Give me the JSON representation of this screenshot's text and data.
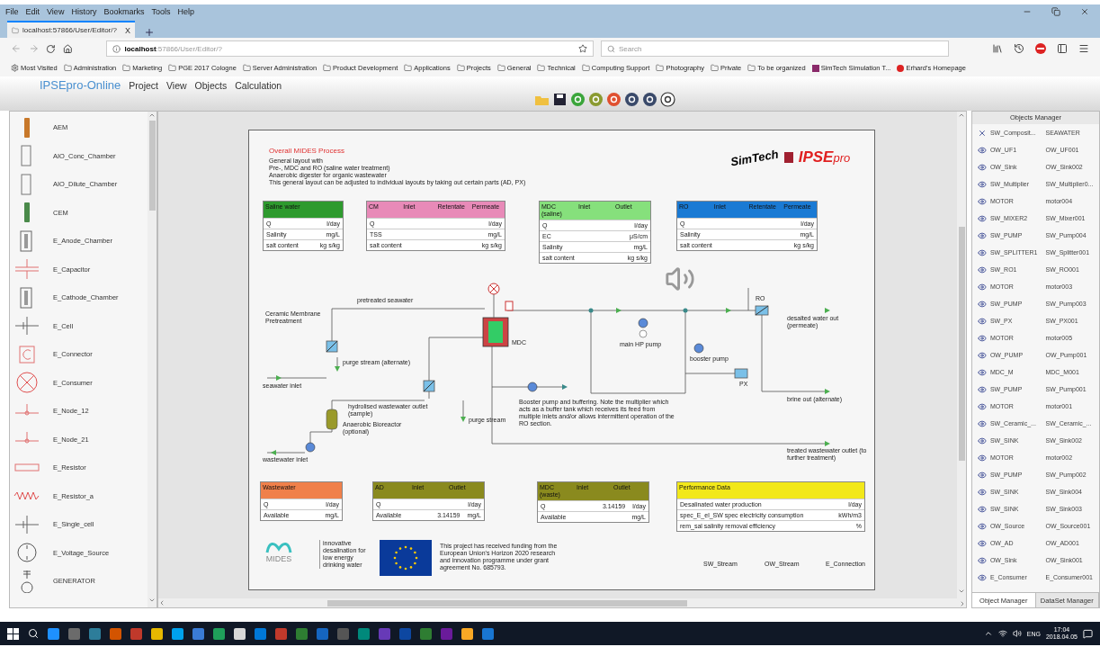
{
  "browser": {
    "menu": [
      "File",
      "Edit",
      "View",
      "History",
      "Bookmarks",
      "Tools",
      "Help"
    ],
    "tab": {
      "title": "localhost:57866/User/Editor/?",
      "close": "X"
    },
    "url_host": "localhost",
    "url_rest": ":57866/User/Editor/?",
    "search_placeholder": "Search",
    "bookmarks": [
      {
        "label": "Most Visited",
        "kind": "gear"
      },
      {
        "label": "Administration",
        "kind": "folder"
      },
      {
        "label": "Marketing",
        "kind": "folder"
      },
      {
        "label": "PGE 2017 Cologne",
        "kind": "folder"
      },
      {
        "label": "Server Administration",
        "kind": "folder"
      },
      {
        "label": "Product Development",
        "kind": "folder"
      },
      {
        "label": "Applications",
        "kind": "folder"
      },
      {
        "label": "Projects",
        "kind": "folder"
      },
      {
        "label": "General",
        "kind": "folder"
      },
      {
        "label": "Technical",
        "kind": "folder"
      },
      {
        "label": "Computing Support",
        "kind": "folder"
      },
      {
        "label": "Photography",
        "kind": "folder"
      },
      {
        "label": "Private",
        "kind": "folder"
      },
      {
        "label": "To be organized",
        "kind": "folder"
      },
      {
        "label": "SimTech Simulation T...",
        "kind": "site"
      },
      {
        "label": "Erhard's Homepage",
        "kind": "home"
      }
    ]
  },
  "app": {
    "brand": "IPSEpro-Online",
    "menu": [
      "Project",
      "View",
      "Objects",
      "Calculation"
    ]
  },
  "palette": [
    {
      "label": "AEM",
      "kind": "membrane",
      "color": "#c8782a"
    },
    {
      "label": "AIO_Conc_Chamber",
      "kind": "chamber"
    },
    {
      "label": "AIO_Dilute_Chamber",
      "kind": "chamber"
    },
    {
      "label": "CEM",
      "kind": "membrane",
      "color": "#4a8a4a"
    },
    {
      "label": "E_Anode_Chamber",
      "kind": "electrode_chamber"
    },
    {
      "label": "E_Capacitor",
      "kind": "capacitor"
    },
    {
      "label": "E_Cathode_Chamber",
      "kind": "electrode_chamber"
    },
    {
      "label": "E_Cell",
      "kind": "cell"
    },
    {
      "label": "E_Connector",
      "kind": "connector"
    },
    {
      "label": "E_Consumer",
      "kind": "consumer"
    },
    {
      "label": "E_Node_12",
      "kind": "node"
    },
    {
      "label": "E_Node_21",
      "kind": "node"
    },
    {
      "label": "E_Resistor",
      "kind": "resistor"
    },
    {
      "label": "E_Resistor_a",
      "kind": "resistor_wave"
    },
    {
      "label": "E_Single_cell",
      "kind": "cell"
    },
    {
      "label": "E_Voltage_Source",
      "kind": "voltage_source"
    },
    {
      "label": "GENERATOR",
      "kind": "generator"
    }
  ],
  "sheet": {
    "title": "Overall MIDES Process",
    "notes": [
      "General layout with",
      "Pre-, MDC and RO (saline water treatment)",
      "Anaerobic digester for organic wastewater",
      "This general layout can be adjusted to individual layouts by taking out certain parts (AD, PX)"
    ],
    "logo_left": "SimTech",
    "logo_right": "IPSE",
    "logo_suffix": "pro",
    "top_tables": [
      {
        "color": "#2e9a2e",
        "headers": [
          "Saline water"
        ],
        "rows": [
          [
            "Q",
            "l/day"
          ],
          [
            "Salinity",
            "mg/L"
          ],
          [
            "salt content",
            "kg s/kg"
          ]
        ]
      },
      {
        "color": "#e88ab8",
        "headers": [
          "CM",
          "Inlet",
          "Retentate",
          "Permeate"
        ],
        "rows": [
          [
            "Q",
            "l/day"
          ],
          [
            "TSS",
            "mg/L"
          ],
          [
            "salt content",
            "kg s/kg"
          ]
        ]
      },
      {
        "color": "#86e07c",
        "headers": [
          "MDC (saline)",
          "Inlet",
          "Outlet"
        ],
        "rows": [
          [
            "Q",
            "l/day"
          ],
          [
            "EC",
            "μS/cm"
          ],
          [
            "Salinity",
            "mg/L"
          ],
          [
            "salt content",
            "kg s/kg"
          ]
        ]
      },
      {
        "color": "#1a7ad4",
        "headers": [
          "RO",
          "Inlet",
          "Retentate",
          "Permeate"
        ],
        "rows": [
          [
            "Q",
            "l/day"
          ],
          [
            "Salinity",
            "mg/L"
          ],
          [
            "salt content",
            "kg s/kg"
          ]
        ]
      }
    ],
    "bottom_tables": [
      {
        "color": "#f0804a",
        "headers": [
          "Wastewater"
        ],
        "rows": [
          [
            "Q",
            "l/day"
          ],
          [
            "Available",
            "mg/L"
          ]
        ]
      },
      {
        "color": "#8a8a1e",
        "headers": [
          "AD",
          "Inlet",
          "Outlet"
        ],
        "rows": [
          [
            "Q",
            "",
            "l/day"
          ],
          [
            "Available",
            "3.14159",
            "mg/L"
          ]
        ]
      },
      {
        "color": "#8a8a1e",
        "headers": [
          "MDC (waste)",
          "Inlet",
          "Outlet"
        ],
        "rows": [
          [
            "Q",
            "3.14159",
            "l/day"
          ],
          [
            "Available",
            "",
            "mg/L"
          ]
        ]
      },
      {
        "color": "#f2e81a",
        "headers": [
          "Performance Data"
        ],
        "rows": [
          [
            "Desalinated water production",
            "l/day"
          ],
          [
            "spec_E_el_SW spec electricity consumption",
            "kWh/m3"
          ],
          [
            "rem_sal salinity removal efficiency",
            "%"
          ]
        ]
      }
    ],
    "labels": [
      "Ceramic Membrane Pretreatment",
      "pretreated seawater",
      "seawater inlet",
      "purge stream (alternate)",
      "hydrolised wastewater outlet (sample)",
      "Anaerobic Bioreactor (optional)",
      "wastewater inlet",
      "purge stream",
      "MDC",
      "main HP pump",
      "booster pump",
      "PX",
      "RO",
      "desalted water out (permeate)",
      "brine out (alternate)",
      "treated wastewater outlet (to further treatment)"
    ],
    "buffer_note": "Booster pump and buffering. Note the multiplier which acts as a buffer tank which receives its feed from multiple inlets and/or allows intermittent operation of the RO section.",
    "mides": "MIDES",
    "mides_tagline": "innovative desalination for low energy drinking water",
    "eu_text": "This project has received funding from the European Union's Horizon 2020 research and innovation programme under grant agreement No. 685793.",
    "legend": [
      "SW_Stream",
      "OW_Stream",
      "E_Connection"
    ]
  },
  "objects_manager": {
    "title": "Objects Manager",
    "rows": [
      {
        "kind": "composition",
        "type": "SW_Composit...",
        "name": "SEAWATER"
      },
      {
        "kind": "object",
        "type": "OW_UF1",
        "name": "OW_UF001"
      },
      {
        "kind": "object",
        "type": "OW_Sink",
        "name": "OW_Sink002"
      },
      {
        "kind": "object",
        "type": "SW_Multiplier",
        "name": "SW_Multiplier0..."
      },
      {
        "kind": "object",
        "type": "MOTOR",
        "name": "motor004"
      },
      {
        "kind": "object",
        "type": "SW_MIXER2",
        "name": "SW_Mixer001"
      },
      {
        "kind": "object",
        "type": "SW_PUMP",
        "name": "SW_Pump004"
      },
      {
        "kind": "object",
        "type": "SW_SPLITTER1",
        "name": "SW_Splitter001"
      },
      {
        "kind": "object",
        "type": "SW_RO1",
        "name": "SW_RO001"
      },
      {
        "kind": "object",
        "type": "MOTOR",
        "name": "motor003"
      },
      {
        "kind": "object",
        "type": "SW_PUMP",
        "name": "SW_Pump003"
      },
      {
        "kind": "object",
        "type": "SW_PX",
        "name": "SW_PX001"
      },
      {
        "kind": "object",
        "type": "MOTOR",
        "name": "motor005"
      },
      {
        "kind": "object",
        "type": "OW_PUMP",
        "name": "OW_Pump001"
      },
      {
        "kind": "object",
        "type": "MDC_M",
        "name": "MDC_M001"
      },
      {
        "kind": "object",
        "type": "SW_PUMP",
        "name": "SW_Pump001"
      },
      {
        "kind": "object",
        "type": "MOTOR",
        "name": "motor001"
      },
      {
        "kind": "object",
        "type": "SW_Ceramic_...",
        "name": "SW_Ceramic_..."
      },
      {
        "kind": "object",
        "type": "SW_SINK",
        "name": "SW_Sink002"
      },
      {
        "kind": "object",
        "type": "MOTOR",
        "name": "motor002"
      },
      {
        "kind": "object",
        "type": "SW_PUMP",
        "name": "SW_Pump002"
      },
      {
        "kind": "object",
        "type": "SW_SINK",
        "name": "SW_Sink004"
      },
      {
        "kind": "object",
        "type": "SW_SINK",
        "name": "SW_Sink003"
      },
      {
        "kind": "object",
        "type": "OW_Source",
        "name": "OW_Source001"
      },
      {
        "kind": "object",
        "type": "OW_AD",
        "name": "OW_AD001"
      },
      {
        "kind": "object",
        "type": "OW_Sink",
        "name": "OW_Sink001"
      },
      {
        "kind": "object",
        "type": "E_Consumer",
        "name": "E_Consumer001"
      }
    ],
    "tabs": [
      {
        "label": "Object Manager",
        "selected": true
      },
      {
        "label": "DataSet Manager",
        "selected": false
      }
    ]
  },
  "taskbar": {
    "language": "ENG",
    "time": "17:04",
    "date": "2018.04.05"
  }
}
